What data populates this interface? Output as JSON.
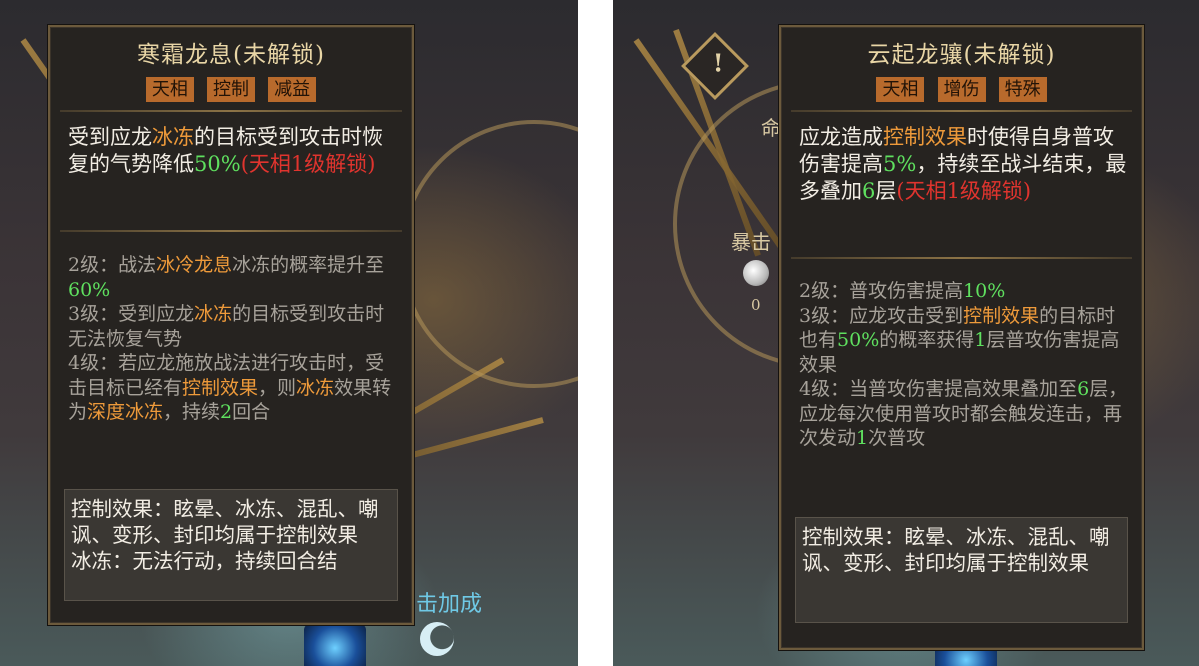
{
  "left": {
    "title": "寒霜龙息(未解锁)",
    "tags": [
      "天相",
      "控制",
      "减益"
    ],
    "main_desc": {
      "a": "受到应龙",
      "b": "冰冻",
      "c": "的目标受到攻击时恢复的气势降低",
      "d": "50%",
      "e": "(天相1级解锁)"
    },
    "lv2": {
      "a": "2级：战法",
      "b": "冰冷龙息",
      "c": "冰冻的概率提升至",
      "d": "60%"
    },
    "lv3": {
      "a": "3级：受到应龙",
      "b": "冰冻",
      "c": "的目标受到攻击时无法恢复气势"
    },
    "lv4": {
      "a": "4级：若应龙施放战法进行攻击时，受击目标已经有",
      "b": "控制效果",
      "c": "，则",
      "d": "冰冻",
      "e": "效果转为",
      "f": "深度冰冻",
      "g": "，持续",
      "h": "2",
      "i": "回合"
    },
    "note": {
      "line1": "控制效果：眩晕、冰冻、混乱、嘲讽、变形、封印均属于控制效果",
      "line2": "冰冻：无法行动，持续回合结"
    }
  },
  "right": {
    "title": "云起龙骧(未解锁)",
    "tags": [
      "天相",
      "增伤",
      "特殊"
    ],
    "main_desc": {
      "a": "应龙造成",
      "b": "控制效果",
      "c": "时使得自身普攻伤害提高",
      "d": "5%",
      "e": "，持续至战斗结束，最多叠加",
      "f": "6",
      "g": "层",
      "h": "(天相1级解锁)"
    },
    "lv2": {
      "a": "2级：普攻伤害提高",
      "b": "10%"
    },
    "lv3": {
      "a": "3级：应龙攻击受到",
      "b": "控制效果",
      "c": "的目标时也有",
      "d": "50%",
      "e": "的概率获得",
      "f": "1",
      "g": "层普攻伤害提高效果"
    },
    "lv4": {
      "a": "4级：当普攻伤害提高效果叠加至",
      "b": "6",
      "c": "层，应龙每次使用普攻时都会触发连击，再次发动",
      "d": "1",
      "e": "次普攻"
    },
    "note": {
      "line1": "控制效果：眩晕、冰冻、混乱、嘲讽、变形、封印均属于控制效果"
    }
  },
  "background": {
    "left_label_crit_faint": "暴击",
    "left_label_bonus": "击加成",
    "right_label_crit": "暴击",
    "right_label_ming": "命",
    "right_value_zero": "0",
    "warning_symbol": "!"
  }
}
